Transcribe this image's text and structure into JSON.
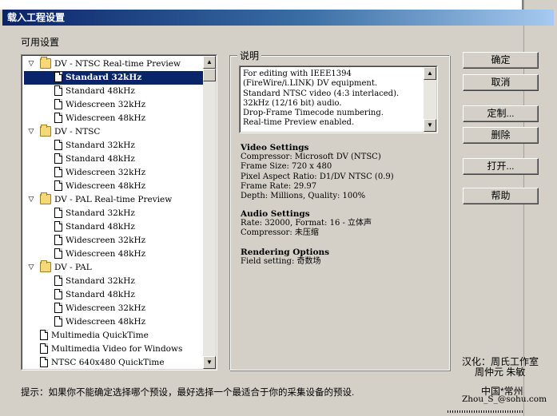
{
  "window": {
    "title": "载入工程设置"
  },
  "available_label": "可用设置",
  "tree": {
    "items": [
      {
        "type": "folder",
        "expanded": true,
        "label": "DV - NTSC Real-time Preview",
        "icon": "folder-icon"
      },
      {
        "type": "leaf",
        "label": "Standard 32kHz",
        "selected": true,
        "icon": "document-icon"
      },
      {
        "type": "leaf",
        "label": "Standard 48kHz",
        "icon": "document-icon"
      },
      {
        "type": "leaf",
        "label": "Widescreen 32kHz",
        "icon": "document-icon"
      },
      {
        "type": "leaf",
        "label": "Widescreen 48kHz",
        "icon": "document-icon"
      },
      {
        "type": "folder",
        "expanded": true,
        "label": "DV - NTSC",
        "icon": "folder-icon"
      },
      {
        "type": "leaf",
        "label": "Standard 32kHz",
        "icon": "document-icon"
      },
      {
        "type": "leaf",
        "label": "Standard 48kHz",
        "icon": "document-icon"
      },
      {
        "type": "leaf",
        "label": "Widescreen 32kHz",
        "icon": "document-icon"
      },
      {
        "type": "leaf",
        "label": "Widescreen 48kHz",
        "icon": "document-icon"
      },
      {
        "type": "folder",
        "expanded": true,
        "label": "DV - PAL Real-time Preview",
        "icon": "folder-icon"
      },
      {
        "type": "leaf",
        "label": "Standard 32kHz",
        "icon": "document-icon"
      },
      {
        "type": "leaf",
        "label": "Standard 48kHz",
        "icon": "document-icon"
      },
      {
        "type": "leaf",
        "label": "Widescreen 32kHz",
        "icon": "document-icon"
      },
      {
        "type": "leaf",
        "label": "Widescreen 48kHz",
        "icon": "document-icon"
      },
      {
        "type": "folder",
        "expanded": true,
        "label": "DV - PAL",
        "icon": "folder-icon"
      },
      {
        "type": "leaf",
        "label": "Standard 32kHz",
        "icon": "document-icon"
      },
      {
        "type": "leaf",
        "label": "Standard 48kHz",
        "icon": "document-icon"
      },
      {
        "type": "leaf",
        "label": "Widescreen 32kHz",
        "icon": "document-icon"
      },
      {
        "type": "leaf",
        "label": "Widescreen 48kHz",
        "icon": "document-icon"
      },
      {
        "type": "top",
        "label": "Multimedia QuickTime",
        "icon": "document-icon"
      },
      {
        "type": "top",
        "label": "Multimedia Video for Windows",
        "icon": "document-icon"
      },
      {
        "type": "top",
        "label": "NTSC 640x480 QuickTime",
        "icon": "document-icon"
      }
    ]
  },
  "description": {
    "label": "说明",
    "text": "For editing with IEEE1394\n(FireWire/i.LINK) DV equipment.\nStandard NTSC video (4:3 interlaced).\n32kHz (12/16 bit) audio.\nDrop-Frame Timecode numbering.\nReal-time Preview enabled."
  },
  "video_settings": {
    "heading": "Video Settings",
    "lines": [
      "Compressor: Microsoft DV (NTSC)",
      "Frame Size: 720 x 480",
      "Pixel Aspect Ratio: D1/DV NTSC (0.9)",
      "Frame Rate: 29.97",
      "Depth: Millions, Quality: 100%"
    ]
  },
  "audio_settings": {
    "heading": "Audio Settings",
    "lines": [
      "Rate: 32000, Format: 16 - 立体声",
      "Compressor: 未压缩"
    ]
  },
  "rendering_options": {
    "heading": "Rendering Options",
    "lines": [
      "Field setting: 奇数场"
    ]
  },
  "buttons": {
    "ok": "确定",
    "cancel": "取消",
    "custom": "定制...",
    "delete": "删除",
    "open": "打开...",
    "help": "帮助"
  },
  "credits": {
    "line1": "汉化：周氏工作室",
    "line2": "周仲元 朱敏",
    "line3": "中国*常州",
    "line4": "Zhou_S_@sohu.com"
  },
  "hint": "提示：如果你不能确定选择哪个预设，最好选择一个最适合于你的采集设备的预设."
}
